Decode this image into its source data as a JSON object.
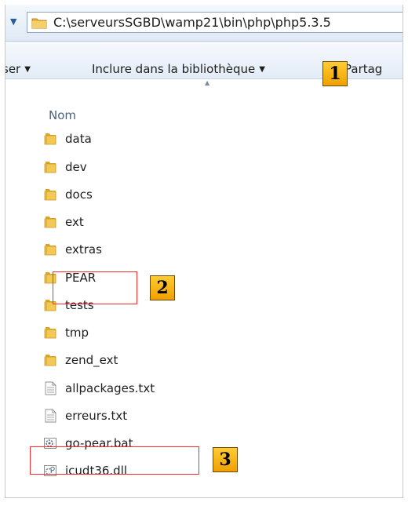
{
  "address": {
    "path": "C:\\serveursSGBD\\wamp21\\bin\\php\\php5.3.5"
  },
  "toolbar": {
    "organize_label": "ser",
    "include_label": "Inclure dans la bibliothèque",
    "share_label": "Partag"
  },
  "list_header": {
    "name_label": "Nom"
  },
  "files": [
    {
      "name": "data",
      "icon": "folder-icon"
    },
    {
      "name": "dev",
      "icon": "folder-icon"
    },
    {
      "name": "docs",
      "icon": "folder-icon"
    },
    {
      "name": "ext",
      "icon": "folder-icon"
    },
    {
      "name": "extras",
      "icon": "folder-icon"
    },
    {
      "name": "PEAR",
      "icon": "folder-icon"
    },
    {
      "name": "tests",
      "icon": "folder-icon"
    },
    {
      "name": "tmp",
      "icon": "folder-icon"
    },
    {
      "name": "zend_ext",
      "icon": "folder-icon"
    },
    {
      "name": "allpackages.txt",
      "icon": "text-file-icon"
    },
    {
      "name": "erreurs.txt",
      "icon": "text-file-icon"
    },
    {
      "name": "go-pear.bat",
      "icon": "batch-file-icon"
    },
    {
      "name": "icudt36.dll",
      "icon": "dll-file-icon"
    }
  ],
  "annotations": {
    "badge1": "1",
    "badge2": "2",
    "badge3": "3"
  },
  "colors": {
    "highlight_box": "#ff2a2a",
    "badge_fill": "#ffcc33",
    "folder": "#e8b73a"
  }
}
